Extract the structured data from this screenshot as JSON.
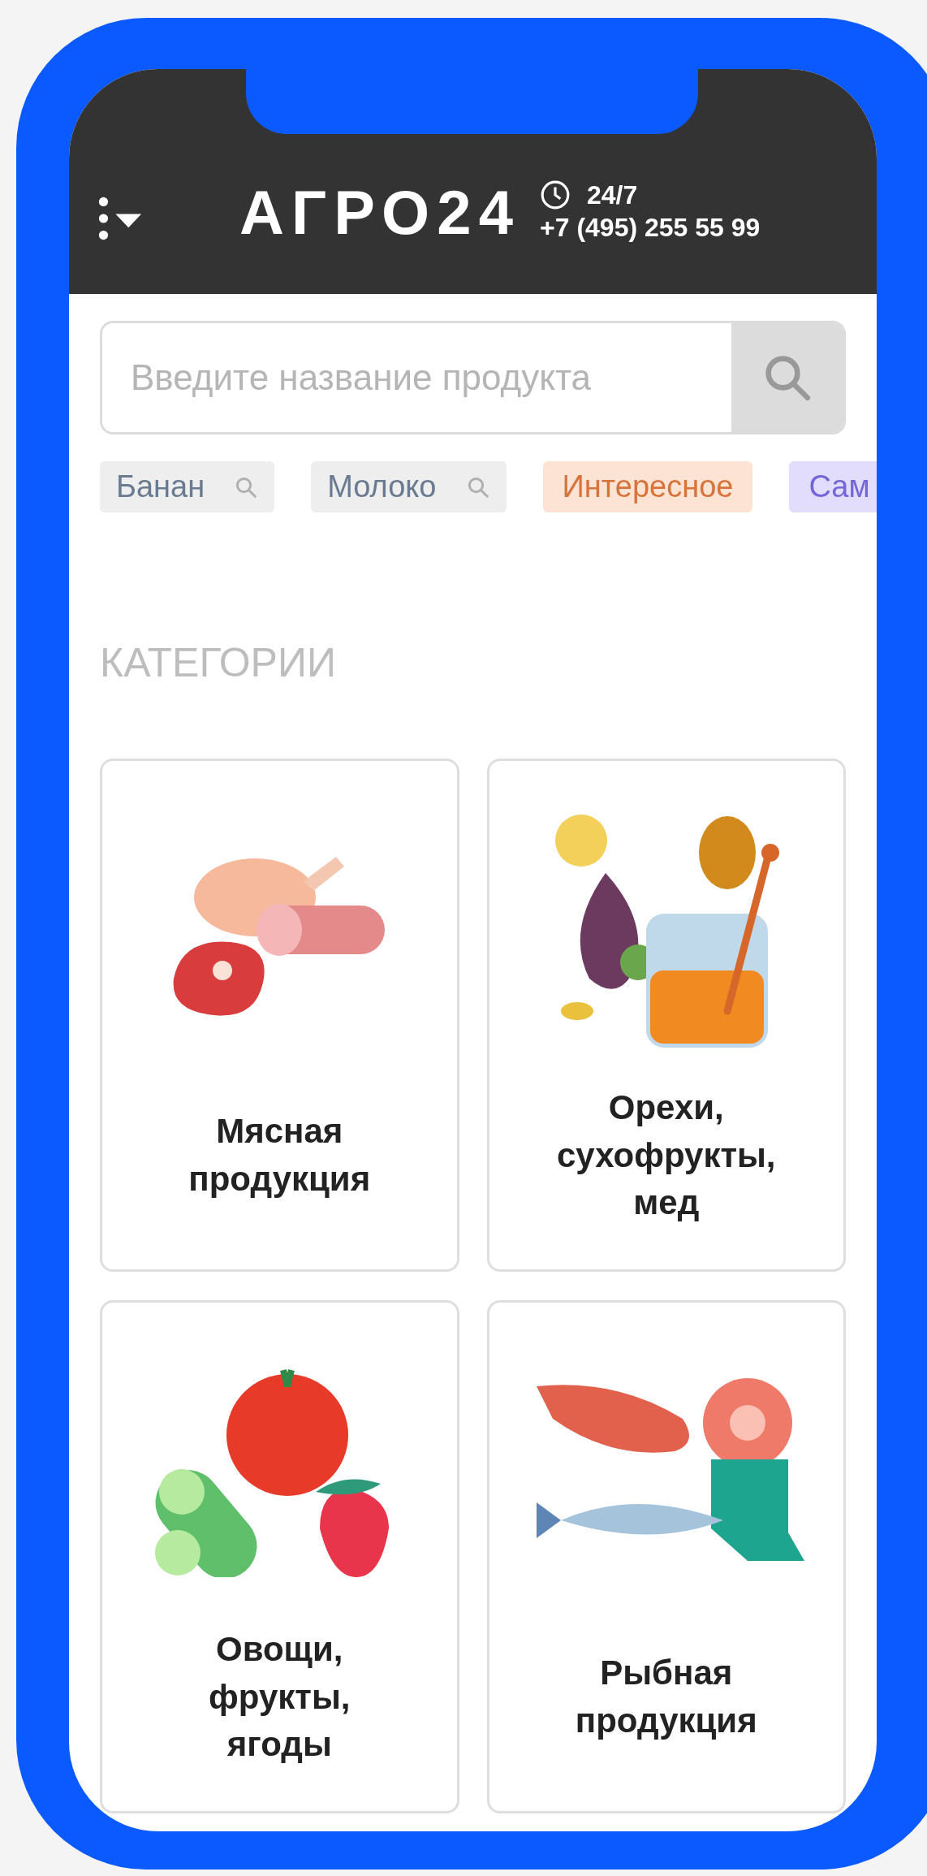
{
  "header": {
    "logo": "АГРО24",
    "hours": "24/7",
    "phone": "+7 (495) 255 55 99"
  },
  "search": {
    "placeholder": "Введите название продукта"
  },
  "tags": [
    {
      "label": "Банан",
      "kind": "search"
    },
    {
      "label": "Молоко",
      "kind": "search"
    },
    {
      "label": "Интересное",
      "kind": "topic",
      "color": "#fde3d3"
    },
    {
      "label": "Сам",
      "kind": "topic",
      "color": "#e2dcfd"
    }
  ],
  "section_title": "КАТЕГОРИИ",
  "categories": [
    {
      "title": "Мясная продукция",
      "kind": "meat"
    },
    {
      "title": "Орехи, сухофрукты, мед",
      "kind": "nuts"
    },
    {
      "title": "Овощи, фрукты, ягоды",
      "kind": "vegetables"
    },
    {
      "title": "Рыбная продукция",
      "kind": "fish"
    }
  ]
}
